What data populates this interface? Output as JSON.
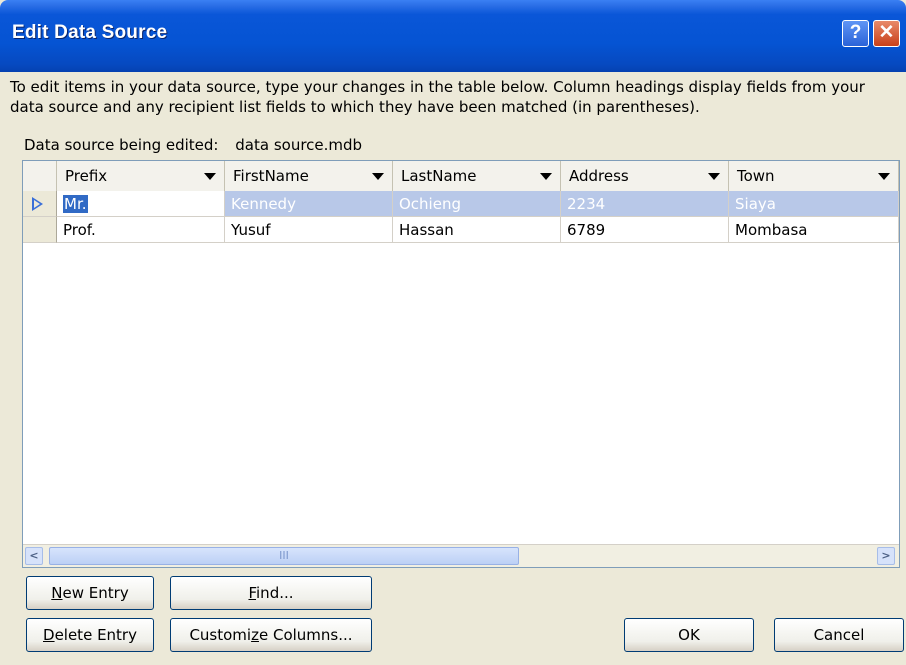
{
  "dialog": {
    "title": "Edit Data Source",
    "help_glyph": "?",
    "close_glyph": "✕",
    "description": "To edit items in your data source, type your changes in the table below. Column headings display fields from your data source and any recipient list fields to which they have been matched (in parentheses).",
    "source_label": "Data source being edited:",
    "source_file": "data source.mdb"
  },
  "table": {
    "columns": [
      "Prefix",
      "FirstName",
      "LastName",
      "Address",
      "Town"
    ],
    "rows": [
      {
        "prefix": "Mr.",
        "firstname": "Kennedy",
        "lastname": "Ochieng",
        "address": "2234",
        "town": "Siaya",
        "selected": true
      },
      {
        "prefix": "Prof.",
        "firstname": "Yusuf",
        "lastname": "Hassan",
        "address": "6789",
        "town": "Mombasa",
        "selected": false
      }
    ],
    "scroll_left_glyph": "<",
    "scroll_right_glyph": ">",
    "scroll_thumb_grip": "III"
  },
  "buttons": {
    "new_entry_u": "N",
    "new_entry_rest": "ew Entry",
    "find_u": "F",
    "find_rest": "ind...",
    "delete_entry_u": "D",
    "delete_entry_rest": "elete Entry",
    "customize_pre": "Customi",
    "customize_u": "z",
    "customize_rest": "e Columns...",
    "ok": "OK",
    "cancel": "Cancel"
  }
}
